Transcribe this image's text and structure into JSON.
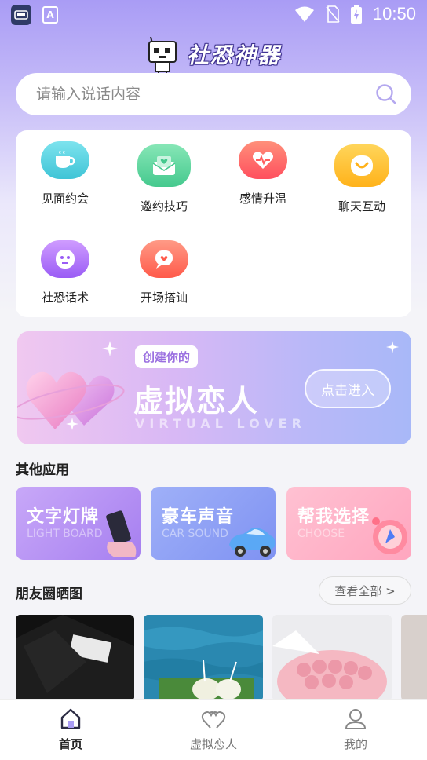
{
  "status_bar": {
    "time": "10:50",
    "app_icon_letter": "A"
  },
  "header": {
    "title": "社恐神器"
  },
  "search": {
    "placeholder": "请输入说话内容"
  },
  "categories": [
    {
      "label": "见面约会",
      "color": "#5fd3e0",
      "icon": "cup-icon"
    },
    {
      "label": "邀约技巧",
      "color": "#62d6a0",
      "icon": "envelope-heart-icon"
    },
    {
      "label": "感情升温",
      "color": "#ff6b6b",
      "icon": "heart-pulse-icon"
    },
    {
      "label": "聊天互动",
      "color": "#ffc93d",
      "icon": "smile-icon"
    },
    {
      "label": "社恐话术",
      "color": "#b07bff",
      "icon": "face-icon"
    },
    {
      "label": "开场搭讪",
      "color": "#ff6f5e",
      "icon": "chat-heart-icon"
    }
  ],
  "banner": {
    "badge": "创建你的",
    "title": "虚拟恋人",
    "subtitle": "VIRTUAL LOVER",
    "button": "点击进入"
  },
  "other_apps": {
    "title": "其他应用",
    "items": [
      {
        "title": "文字灯牌",
        "subtitle": "LIGHT BOARD",
        "color": "#b99bf5"
      },
      {
        "title": "豪车声音",
        "subtitle": "CAR SOUND",
        "color": "#8fa4f7"
      },
      {
        "title": "帮我选择",
        "subtitle": "CHOOSE",
        "color": "#ffb3c6"
      }
    ]
  },
  "moments": {
    "title": "朋友圈晒图",
    "see_all": "查看全部 >"
  },
  "bottom_nav": [
    {
      "label": "首页",
      "active": true
    },
    {
      "label": "虚拟恋人",
      "active": false
    },
    {
      "label": "我的",
      "active": false
    }
  ]
}
